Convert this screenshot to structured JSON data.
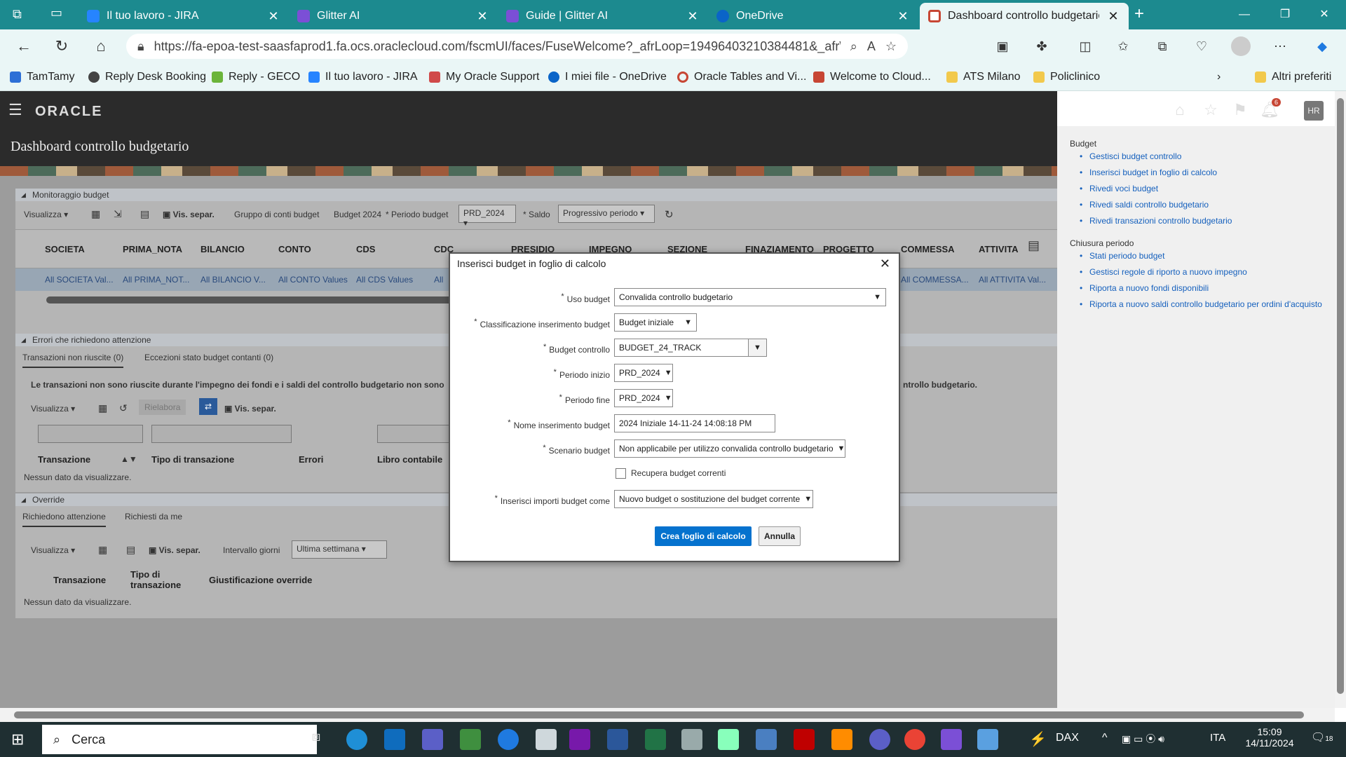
{
  "browser": {
    "tabs": [
      {
        "label": "Il tuo lavoro - JIRA"
      },
      {
        "label": "Glitter AI"
      },
      {
        "label": "Guide | Glitter AI"
      },
      {
        "label": "OneDrive"
      },
      {
        "label": "Dashboard controllo budgetario"
      }
    ],
    "url": "https://fa-epoa-test-saasfaprod1.fa.ocs.oraclecloud.com/fscmUI/faces/FuseWelcome?_afrLoop=19496403210384481&_afrWin...",
    "bookmarks": [
      {
        "label": "TamTamy"
      },
      {
        "label": "Reply Desk Booking"
      },
      {
        "label": "Reply - GECO"
      },
      {
        "label": "Il tuo lavoro - JIRA"
      },
      {
        "label": "My Oracle Support"
      },
      {
        "label": "I miei file - OneDrive"
      },
      {
        "label": "Oracle Tables and Vi..."
      },
      {
        "label": "Welcome to Cloud..."
      },
      {
        "label": "ATS Milano"
      },
      {
        "label": "Policlinico"
      }
    ],
    "other_favorites": "Altri preferiti"
  },
  "app": {
    "logo": "ORACLE",
    "page_title": "Dashboard controllo budgetario",
    "notification_count": "6",
    "user_initials": "HR"
  },
  "sidebar": {
    "sections": [
      {
        "title": "Budget",
        "links": [
          "Gestisci budget controllo",
          "Inserisci budget in foglio di calcolo",
          "Rivedi voci budget",
          "Rivedi saldi controllo budgetario",
          "Rivedi transazioni controllo budgetario"
        ]
      },
      {
        "title": "Chiusura periodo",
        "links": [
          "Stati periodo budget",
          "Gestisci regole di riporto a nuovo impegno",
          "Riporta a nuovo fondi disponibili",
          "Riporta a nuovo saldi controllo budgetario per ordini d'acquisto"
        ]
      }
    ]
  },
  "monitor": {
    "title": "Monitoraggio budget",
    "view": "Visualizza",
    "detach": "Vis. separ.",
    "account_group_label": "Gruppo di conti budget",
    "account_group_value": "Budget 2024",
    "period_label": "Periodo budget",
    "period_value": "PRD_2024",
    "balance_label": "Saldo",
    "balance_value": "Progressivo periodo",
    "columns": [
      "SOCIETA",
      "PRIMA_NOTA",
      "BILANCIO",
      "CONTO",
      "CDS",
      "CDC",
      "PRESIDIO",
      "IMPEGNO",
      "SEZIONE",
      "FINAZIAMENTO",
      "PROGETTO",
      "COMMESSA",
      "ATTIVITA"
    ],
    "row_values": [
      "All SOCIETA Val...",
      "All PRIMA_NOT...",
      "All BILANCIO V...",
      "All CONTO Values",
      "All CDS Values",
      "All",
      "",
      "",
      "",
      "",
      "",
      "All COMMESSA...",
      "All ATTIVITA Val..."
    ]
  },
  "errors": {
    "title": "Errori che richiedono attenzione",
    "tab_failed": "Transazioni non riuscite (0)",
    "tab_exceptions": "Eccezioni stato budget contanti (0)",
    "message_left": "Le transazioni non sono riuscite durante l'impegno dei fondi e i saldi del controllo budgetario non sono",
    "message_right": "ntrollo budgetario.",
    "view": "Visualizza",
    "rework": "Rielabora",
    "detach": "Vis. separ.",
    "columns": [
      "Transazione",
      "Tipo di transazione",
      "Errori",
      "Libro contabile"
    ],
    "empty": "Nessun dato da visualizzare."
  },
  "override": {
    "title": "Override",
    "tab_attention": "Richiedono attenzione",
    "tab_requested": "Richiesti da me",
    "view": "Visualizza",
    "detach": "Vis. separ.",
    "interval_label": "Intervallo giorni",
    "interval_value": "Ultima settimana",
    "columns": [
      "Transazione",
      "Tipo di transazione",
      "Giustificazione override"
    ],
    "empty": "Nessun dato da visualizzare."
  },
  "dialog": {
    "title": "Inserisci budget in foglio di calcolo",
    "fields": {
      "uso_budget": {
        "label": "Uso budget",
        "value": "Convalida controllo budgetario"
      },
      "classificazione": {
        "label": "Classificazione inserimento budget",
        "value": "Budget iniziale"
      },
      "budget_controllo": {
        "label": "Budget controllo",
        "value": "BUDGET_24_TRACK"
      },
      "periodo_inizio": {
        "label": "Periodo inizio",
        "value": "PRD_2024"
      },
      "periodo_fine": {
        "label": "Periodo fine",
        "value": "PRD_2024"
      },
      "nome": {
        "label": "Nome inserimento budget",
        "value": "2024 Iniziale 14-11-24 14:08:18 PM"
      },
      "scenario": {
        "label": "Scenario budget",
        "value": "Non applicabile per utilizzo convalida controllo budgetario"
      },
      "recupera": {
        "label": "Recupera budget correnti",
        "checked": false
      },
      "importi": {
        "label": "Inserisci importi budget come",
        "value": "Nuovo budget o sostituzione del budget corrente"
      }
    },
    "create_button": "Crea foglio di calcolo",
    "cancel_button": "Annulla",
    "accent_color": "#0572ce"
  },
  "taskbar": {
    "search_placeholder": "Cerca",
    "dax_label": "DAX",
    "language": "ITA",
    "time": "15:09",
    "date": "14/11/2024",
    "notifications": "18"
  }
}
